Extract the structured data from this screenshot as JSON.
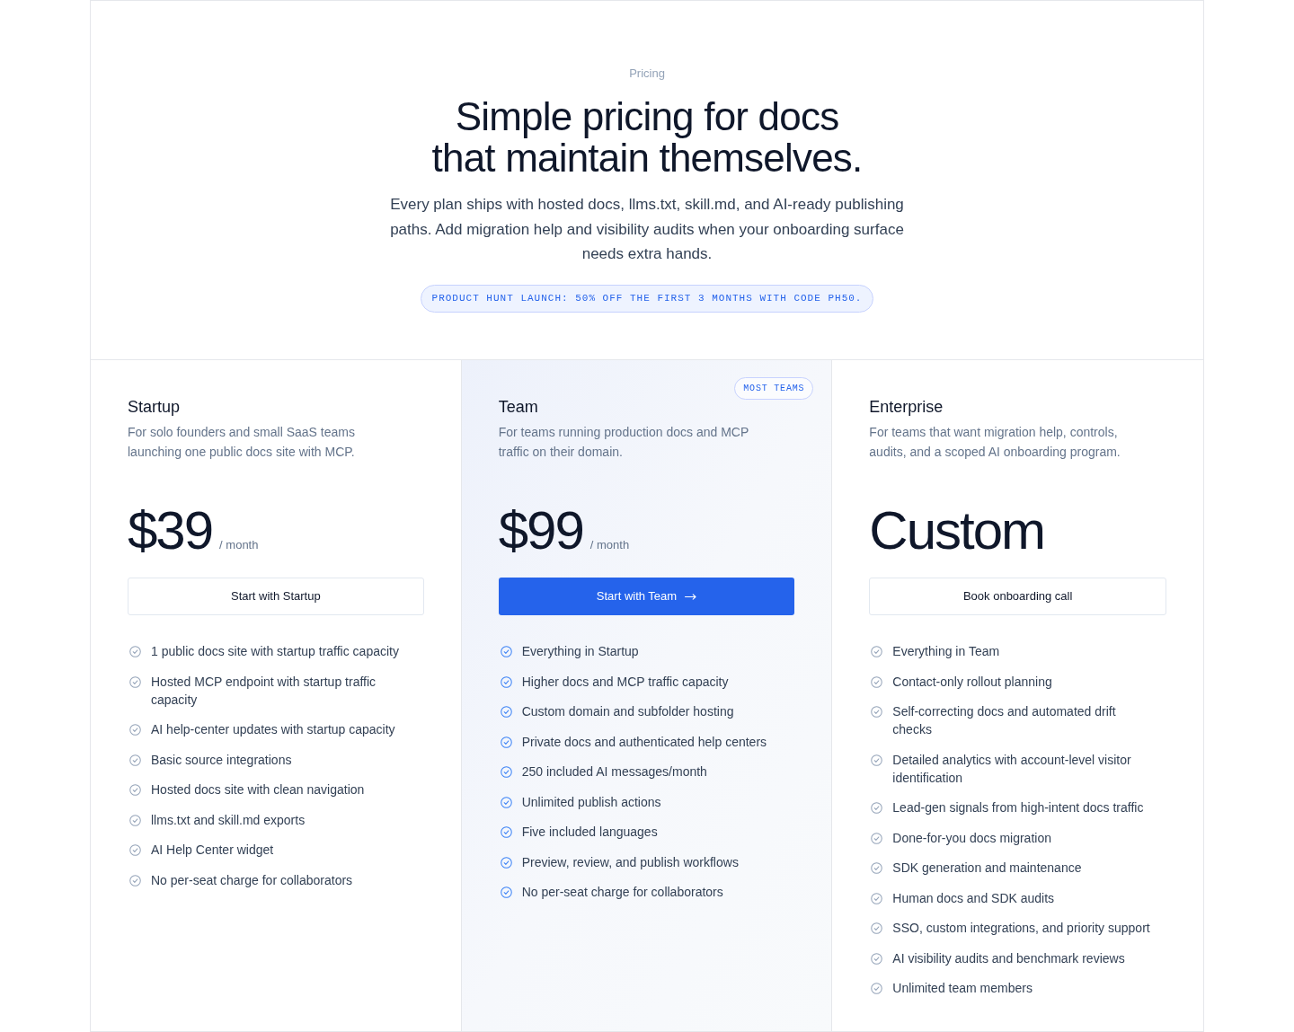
{
  "header": {
    "eyebrow": "Pricing",
    "title_lines": [
      "Simple pricing for docs",
      "that maintain themselves."
    ],
    "description": "Every plan ships with hosted docs, llms.txt, skill.md, and AI-ready publishing paths. Add migration help and visibility audits when your onboarding surface needs extra hands.",
    "promo": "PRODUCT HUNT LAUNCH: 50% OFF THE FIRST 3 MONTHS WITH CODE PH50."
  },
  "plans": [
    {
      "name": "Startup",
      "featured": false,
      "description": "For solo founders and small SaaS teams launching one public docs site with MCP.",
      "price": "$39",
      "period": "/ month",
      "button": "Start with Startup",
      "features": [
        "1 public docs site with startup traffic capacity",
        "Hosted MCP endpoint with startup traffic capacity",
        "AI help-center updates with startup capacity",
        "Basic source integrations",
        "Hosted docs site with clean navigation",
        "llms.txt and skill.md exports",
        "AI Help Center widget",
        "No per-seat charge for collaborators"
      ]
    },
    {
      "name": "Team",
      "featured": true,
      "badge": "MOST TEAMS",
      "description": "For teams running production docs and MCP traffic on their domain.",
      "price": "$99",
      "period": "/ month",
      "button": "Start with Team",
      "features": [
        "Everything in Startup",
        "Higher docs and MCP traffic capacity",
        "Custom domain and subfolder hosting",
        "Private docs and authenticated help centers",
        "250 included AI messages/month",
        "Unlimited publish actions",
        "Five included languages",
        "Preview, review, and publish workflows",
        "No per-seat charge for collaborators"
      ]
    },
    {
      "name": "Enterprise",
      "featured": false,
      "description": "For teams that want migration help, controls, audits, and a scoped AI onboarding program.",
      "price": "Custom",
      "button": "Book onboarding call",
      "features": [
        "Everything in Team",
        "Contact-only rollout planning",
        "Self-correcting docs and automated drift checks",
        "Detailed analytics with account-level visitor identification",
        "Lead-gen signals from high-intent docs traffic",
        "Done-for-you docs migration",
        "SDK generation and maintenance",
        "Human docs and SDK audits",
        "SSO, custom integrations, and priority support",
        "AI visibility audits and benchmark reviews",
        "Unlimited team members"
      ]
    }
  ]
}
